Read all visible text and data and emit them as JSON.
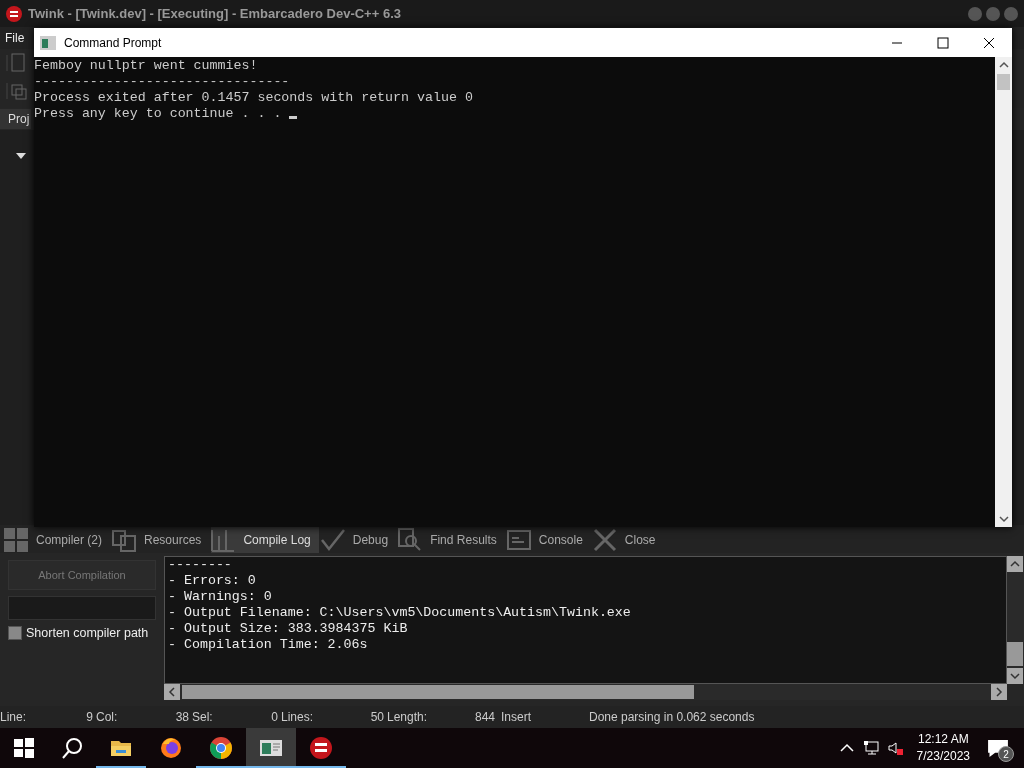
{
  "ide": {
    "title": "Twink - [Twink.dev] - [Executing] - Embarcadero Dev-C++ 6.3",
    "menu": [
      "File"
    ],
    "project_tab": "Proj",
    "bottom_tabs": [
      {
        "label": "Compiler (2)",
        "selected": false
      },
      {
        "label": "Resources",
        "selected": false
      },
      {
        "label": "Compile Log",
        "selected": true
      },
      {
        "label": "Debug",
        "selected": false
      },
      {
        "label": "Find Results",
        "selected": false
      },
      {
        "label": "Console",
        "selected": false
      },
      {
        "label": "Close",
        "selected": false
      }
    ],
    "abort_button": {
      "label": "Abort Compilation",
      "disabled": true
    },
    "progress": {
      "level": 0
    },
    "shorten_path": {
      "label": "Shorten compiler path",
      "checked": false
    },
    "compile_log": [
      "--------",
      "- Errors: 0",
      "- Warnings: 0",
      "- Output Filename: C:\\Users\\vm5\\Documents\\Autism\\Twink.exe",
      "- Output Size: 383.3984375 KiB",
      "- Compilation Time: 2.06s"
    ],
    "status_bar": {
      "fields": [
        {
          "label": "Line:",
          "value": "9"
        },
        {
          "label": "Col:",
          "value": "38"
        },
        {
          "label": "Sel:",
          "value": "0"
        },
        {
          "label": "Lines:",
          "value": "50"
        },
        {
          "label": "Length:",
          "value": "844"
        }
      ],
      "mode": "Insert",
      "message": "Done parsing in 0.062 seconds"
    }
  },
  "command_prompt": {
    "title": "Command Prompt",
    "lines": [
      "Femboy nullptr went cummies!",
      "--------------------------------",
      "Process exited after 0.1457 seconds with return value 0",
      "Press any key to continue . . . "
    ]
  },
  "taskbar": {
    "apps": [
      {
        "kind": "explorer",
        "running": true,
        "active": false
      },
      {
        "kind": "firefox",
        "running": false,
        "active": false
      },
      {
        "kind": "chrome",
        "running": true,
        "active": false
      },
      {
        "kind": "console",
        "running": true,
        "active": true
      },
      {
        "kind": "devcpp",
        "running": true,
        "active": false
      }
    ],
    "time": "12:12 AM",
    "date": "7/23/2023",
    "notifications": "2"
  }
}
